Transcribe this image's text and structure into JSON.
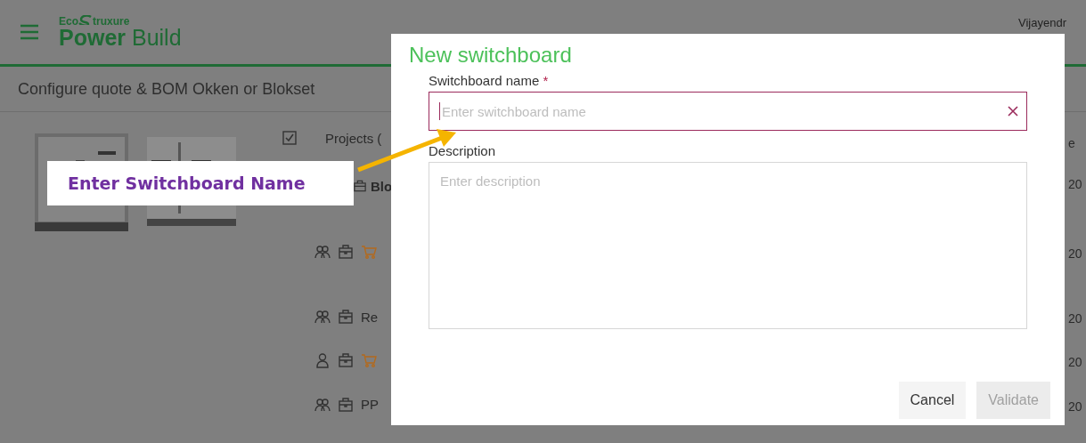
{
  "header": {
    "logo": {
      "prefix": "Eco",
      "suffix": "truxure",
      "brand_bold": "Power",
      "brand_light": "Build"
    },
    "user": "Vijayendr"
  },
  "page_title": "Configure quote & BOM Okken or Blokset",
  "projects": {
    "header_checked": true,
    "header_label": "Projects (",
    "date_header": "e",
    "rows": [
      {
        "kind": "folder",
        "label": "Blo",
        "date": "20"
      },
      {
        "kind": "project",
        "shared": true,
        "in_cart": true,
        "date": "20"
      },
      {
        "kind": "project",
        "shared": true,
        "in_cart": false,
        "label": "Re",
        "date": "20"
      },
      {
        "kind": "project",
        "shared": false,
        "in_cart": true,
        "date": "20"
      },
      {
        "kind": "project",
        "shared": true,
        "in_cart": false,
        "label": "PP",
        "date": "20"
      }
    ]
  },
  "dialog": {
    "title": "New switchboard",
    "name_field": {
      "label": "Switchboard name",
      "required_mark": "*",
      "placeholder": "Enter switchboard name",
      "focused": true
    },
    "description_field": {
      "label": "Description",
      "placeholder": "Enter description"
    },
    "buttons": [
      {
        "label": "Cancel",
        "disabled": false
      },
      {
        "label": "Validate",
        "disabled": true
      }
    ]
  },
  "callout": {
    "text": "Enter Switchboard Name"
  }
}
